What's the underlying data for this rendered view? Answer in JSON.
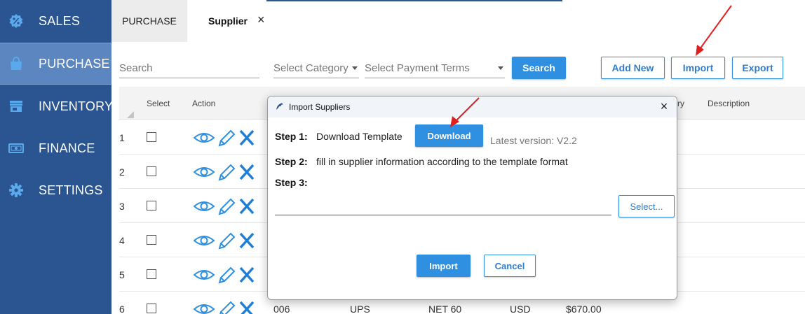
{
  "sidebar": {
    "items": [
      {
        "label": "SALES",
        "icon": "sales-percent-icon"
      },
      {
        "label": "PURCHASE",
        "icon": "shopping-bag-icon",
        "active": true
      },
      {
        "label": "INVENTORY",
        "icon": "store-icon"
      },
      {
        "label": "FINANCE",
        "icon": "money-icon"
      },
      {
        "label": "SETTINGS",
        "icon": "gear-icon"
      }
    ]
  },
  "tabs": {
    "purchase_label": "PURCHASE",
    "supplier_label": "Supplier",
    "close_glyph": "×"
  },
  "toolbar": {
    "search_placeholder": "Search",
    "category_placeholder": "Select Category",
    "payment_terms_placeholder": "Select Payment Terms",
    "search_button": "Search",
    "add_new_button": "Add New",
    "import_button": "Import",
    "export_button": "Export"
  },
  "table": {
    "headers": {
      "select": "Select",
      "action": "Action",
      "category_partial": "ry",
      "description": "Description"
    },
    "rows": [
      {
        "num": "1"
      },
      {
        "num": "2"
      },
      {
        "num": "3"
      },
      {
        "num": "4"
      },
      {
        "num": "5"
      },
      {
        "num": "6",
        "code": "006",
        "carrier": "UPS",
        "terms": "NET 60",
        "currency": "USD",
        "amount": "$670.00"
      }
    ]
  },
  "modal": {
    "title": "Import Suppliers",
    "close_glyph": "×",
    "step1_label": "Step 1:",
    "step1_text": "Download Template",
    "download_button": "Download",
    "version_label": "Latest version:",
    "version_value": "V2.2",
    "step2_label": "Step 2:",
    "step2_text": "fill in supplier information according to the template format",
    "step3_label": "Step 3:",
    "select_button": "Select...",
    "import_button": "Import",
    "cancel_button": "Cancel"
  },
  "colors": {
    "sidebar_bg": "#2a5590",
    "sidebar_active": "#5c86bf",
    "primary": "#2f8fe0",
    "arrow": "#e02020"
  }
}
